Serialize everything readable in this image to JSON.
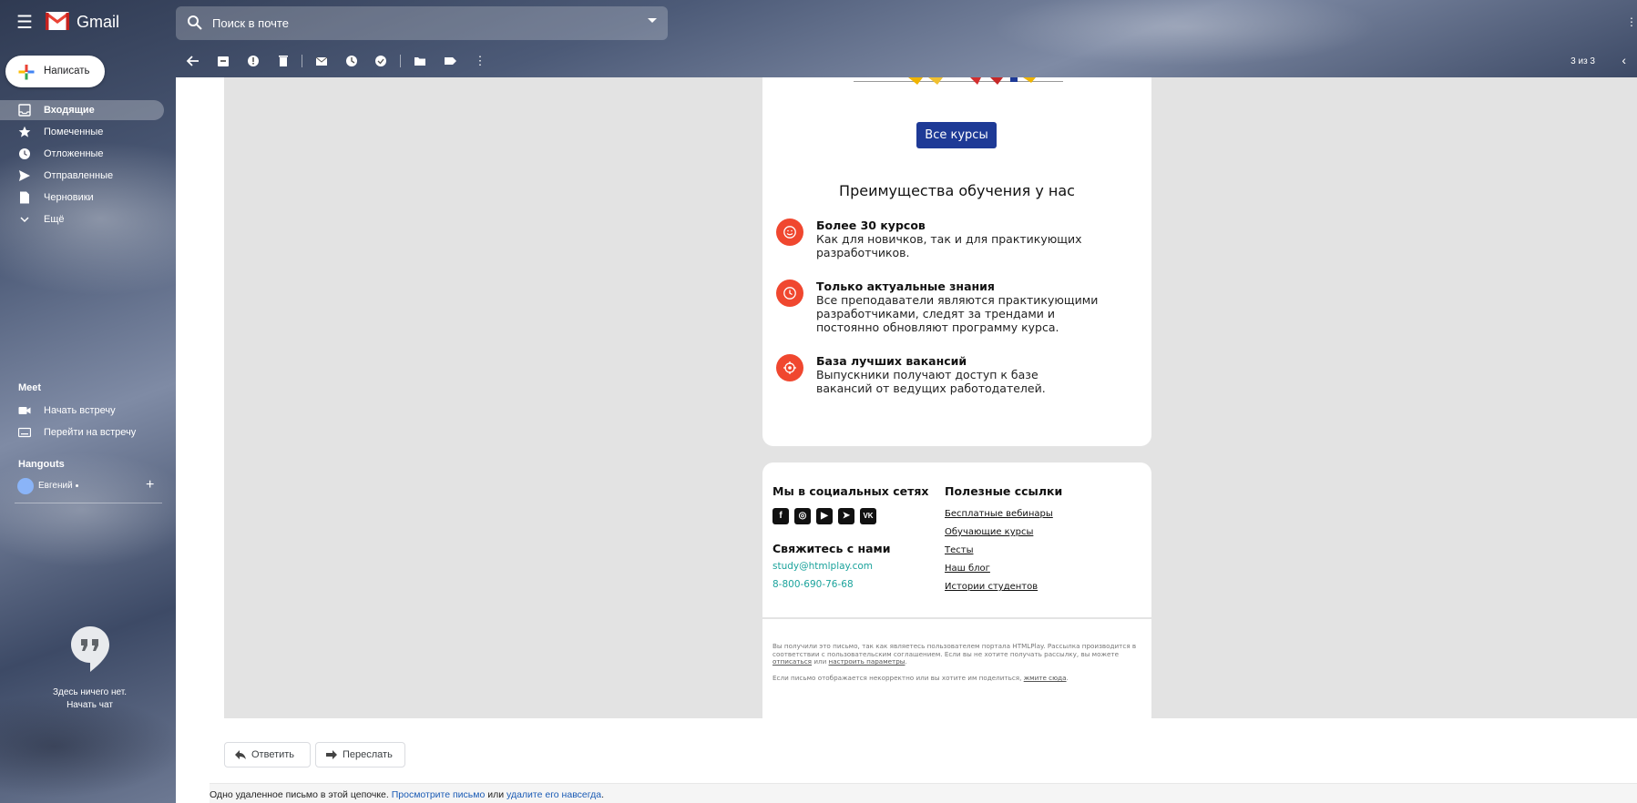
{
  "app": {
    "name": "Gmail"
  },
  "search": {
    "placeholder": "Поиск в почте"
  },
  "toolbar": {
    "pager": "3 из 3"
  },
  "compose": {
    "label": "Написать"
  },
  "sidebar": {
    "items": [
      {
        "label": "Входящие",
        "icon": "inbox-icon"
      },
      {
        "label": "Помеченные",
        "icon": "star-icon"
      },
      {
        "label": "Отложенные",
        "icon": "clock-icon"
      },
      {
        "label": "Отправленные",
        "icon": "send-icon"
      },
      {
        "label": "Черновики",
        "icon": "draft-icon"
      },
      {
        "label": "Ещё",
        "icon": "chevron-down-icon"
      }
    ],
    "meet": {
      "title": "Meet",
      "items": [
        {
          "label": "Начать встречу",
          "icon": "video-icon"
        },
        {
          "label": "Перейти на встречу",
          "icon": "keyboard-icon"
        }
      ]
    },
    "hangouts": {
      "title": "Hangouts",
      "user": "Евгений",
      "empty_text": "Здесь ничего нет.",
      "start_chat": "Начать чат"
    }
  },
  "email": {
    "all_courses_button": "Все курсы",
    "advantages_title": "Преимущества обучения у нас",
    "features": [
      {
        "title": "Более 30 курсов",
        "desc": "Как для новичков, так и для практикующих разработчиков.",
        "icon": "smile-icon"
      },
      {
        "title": "Только актуальные знания",
        "desc": "Все преподаватели являются практикующими разработчиками, следят за трендами и постоянно обновляют программу курса.",
        "icon": "clock-icon"
      },
      {
        "title": "База лучших вакансий",
        "desc": "Выпускники получают доступ к базе вакансий от ведущих работодателей.",
        "icon": "target-icon"
      }
    ],
    "footer": {
      "social_title": "Мы в социальных сетях",
      "social_icons": [
        "facebook-icon",
        "instagram-icon",
        "youtube-icon",
        "telegram-icon",
        "vk-icon"
      ],
      "contact_title": "Свяжитесь с нами",
      "email": "study@htmlplay.com",
      "phone": "8-800-690-76-68",
      "links_title": "Полезные ссылки",
      "links": [
        "Бесплатные вебинары",
        "Обучающие курсы",
        "Тесты",
        "Наш блог",
        "Истории студентов"
      ],
      "legal_1": "Вы получили это письмо, так как являетесь пользователем портала HTMLPlay. Рассылка производится в соответствии с пользовательским соглашением. Если вы не хотите получать рассылку, вы можете",
      "legal_unsubscribe": "отписаться",
      "legal_or": "или",
      "legal_settings": "настроить параметры",
      "legal_2": "Если письмо отображается некорректно или вы хотите им поделиться,",
      "legal_click": "жмите сюда"
    }
  },
  "actions": {
    "reply": "Ответить",
    "forward": "Переслать"
  },
  "notice": {
    "text": "Одно удаленное письмо в этой цепочке.",
    "view_link": "Просмотрите письмо",
    "or": "или",
    "delete_link": "удалите его навсегда"
  }
}
